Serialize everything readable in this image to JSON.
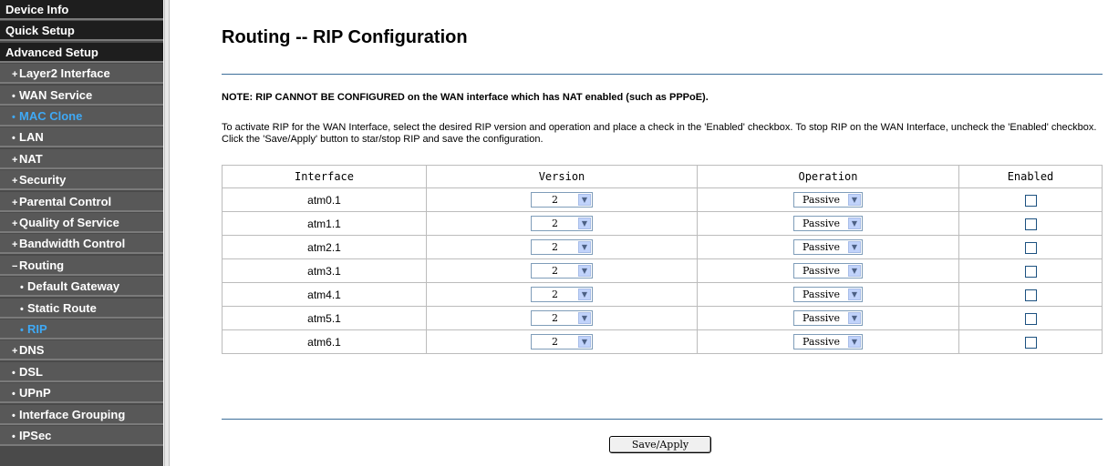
{
  "sidebar": {
    "items": [
      {
        "label": "Device Info",
        "prefix": "",
        "style": "top",
        "active": false
      },
      {
        "label": "Quick Setup",
        "prefix": "",
        "style": "top",
        "active": false
      },
      {
        "label": "Advanced Setup",
        "prefix": "",
        "style": "top",
        "active": false
      },
      {
        "label": "Layer2 Interface",
        "prefix": "+",
        "style": "sub",
        "active": false
      },
      {
        "label": "WAN Service",
        "prefix": "•",
        "style": "sub",
        "active": false
      },
      {
        "label": "MAC Clone",
        "prefix": "•",
        "style": "sub",
        "active": true
      },
      {
        "label": "LAN",
        "prefix": "•",
        "style": "sub",
        "active": false
      },
      {
        "label": "NAT",
        "prefix": "+",
        "style": "sub",
        "active": false
      },
      {
        "label": "Security",
        "prefix": "+",
        "style": "sub",
        "active": false
      },
      {
        "label": "Parental Control",
        "prefix": "+",
        "style": "sub",
        "active": false
      },
      {
        "label": "Quality of Service",
        "prefix": "+",
        "style": "sub",
        "active": false
      },
      {
        "label": "Bandwidth Control",
        "prefix": "+",
        "style": "sub",
        "active": false
      },
      {
        "label": "Routing",
        "prefix": "−",
        "style": "sub",
        "active": false
      },
      {
        "label": "Default Gateway",
        "prefix": "•",
        "style": "sub2",
        "active": false
      },
      {
        "label": "Static Route",
        "prefix": "•",
        "style": "sub2",
        "active": false
      },
      {
        "label": "RIP",
        "prefix": "•",
        "style": "sub2",
        "active": true
      },
      {
        "label": "DNS",
        "prefix": "+",
        "style": "sub",
        "active": false
      },
      {
        "label": "DSL",
        "prefix": "•",
        "style": "sub",
        "active": false
      },
      {
        "label": "UPnP",
        "prefix": "•",
        "style": "sub",
        "active": false
      },
      {
        "label": "Interface Grouping",
        "prefix": "•",
        "style": "sub",
        "active": false
      },
      {
        "label": "IPSec",
        "prefix": "•",
        "style": "sub",
        "active": false
      }
    ]
  },
  "main": {
    "title": "Routing -- RIP Configuration",
    "note": "NOTE: RIP CANNOT BE CONFIGURED on the WAN interface which has NAT enabled (such as PPPoE).",
    "description": "To activate RIP for the WAN Interface, select the desired RIP version and operation and place a check in the 'Enabled' checkbox. To stop RIP on the WAN Interface, uncheck the 'Enabled' checkbox. Click the 'Save/Apply' button to star/stop RIP and save the configuration.",
    "table": {
      "headers": [
        "Interface",
        "Version",
        "Operation",
        "Enabled"
      ],
      "rows": [
        {
          "interface": "atm0.1",
          "version": "2",
          "operation": "Passive",
          "enabled": false
        },
        {
          "interface": "atm1.1",
          "version": "2",
          "operation": "Passive",
          "enabled": false
        },
        {
          "interface": "atm2.1",
          "version": "2",
          "operation": "Passive",
          "enabled": false
        },
        {
          "interface": "atm3.1",
          "version": "2",
          "operation": "Passive",
          "enabled": false
        },
        {
          "interface": "atm4.1",
          "version": "2",
          "operation": "Passive",
          "enabled": false
        },
        {
          "interface": "atm5.1",
          "version": "2",
          "operation": "Passive",
          "enabled": false
        },
        {
          "interface": "atm6.1",
          "version": "2",
          "operation": "Passive",
          "enabled": false
        }
      ]
    },
    "save_label": "Save/Apply"
  },
  "colors": {
    "sidebar_bg": "#585858",
    "sidebar_top_bg": "#1e1e1e",
    "active_text": "#3fa9f5",
    "divider": "#3c6e9a"
  },
  "icons": {
    "dropdown": "chevron-down-icon"
  }
}
